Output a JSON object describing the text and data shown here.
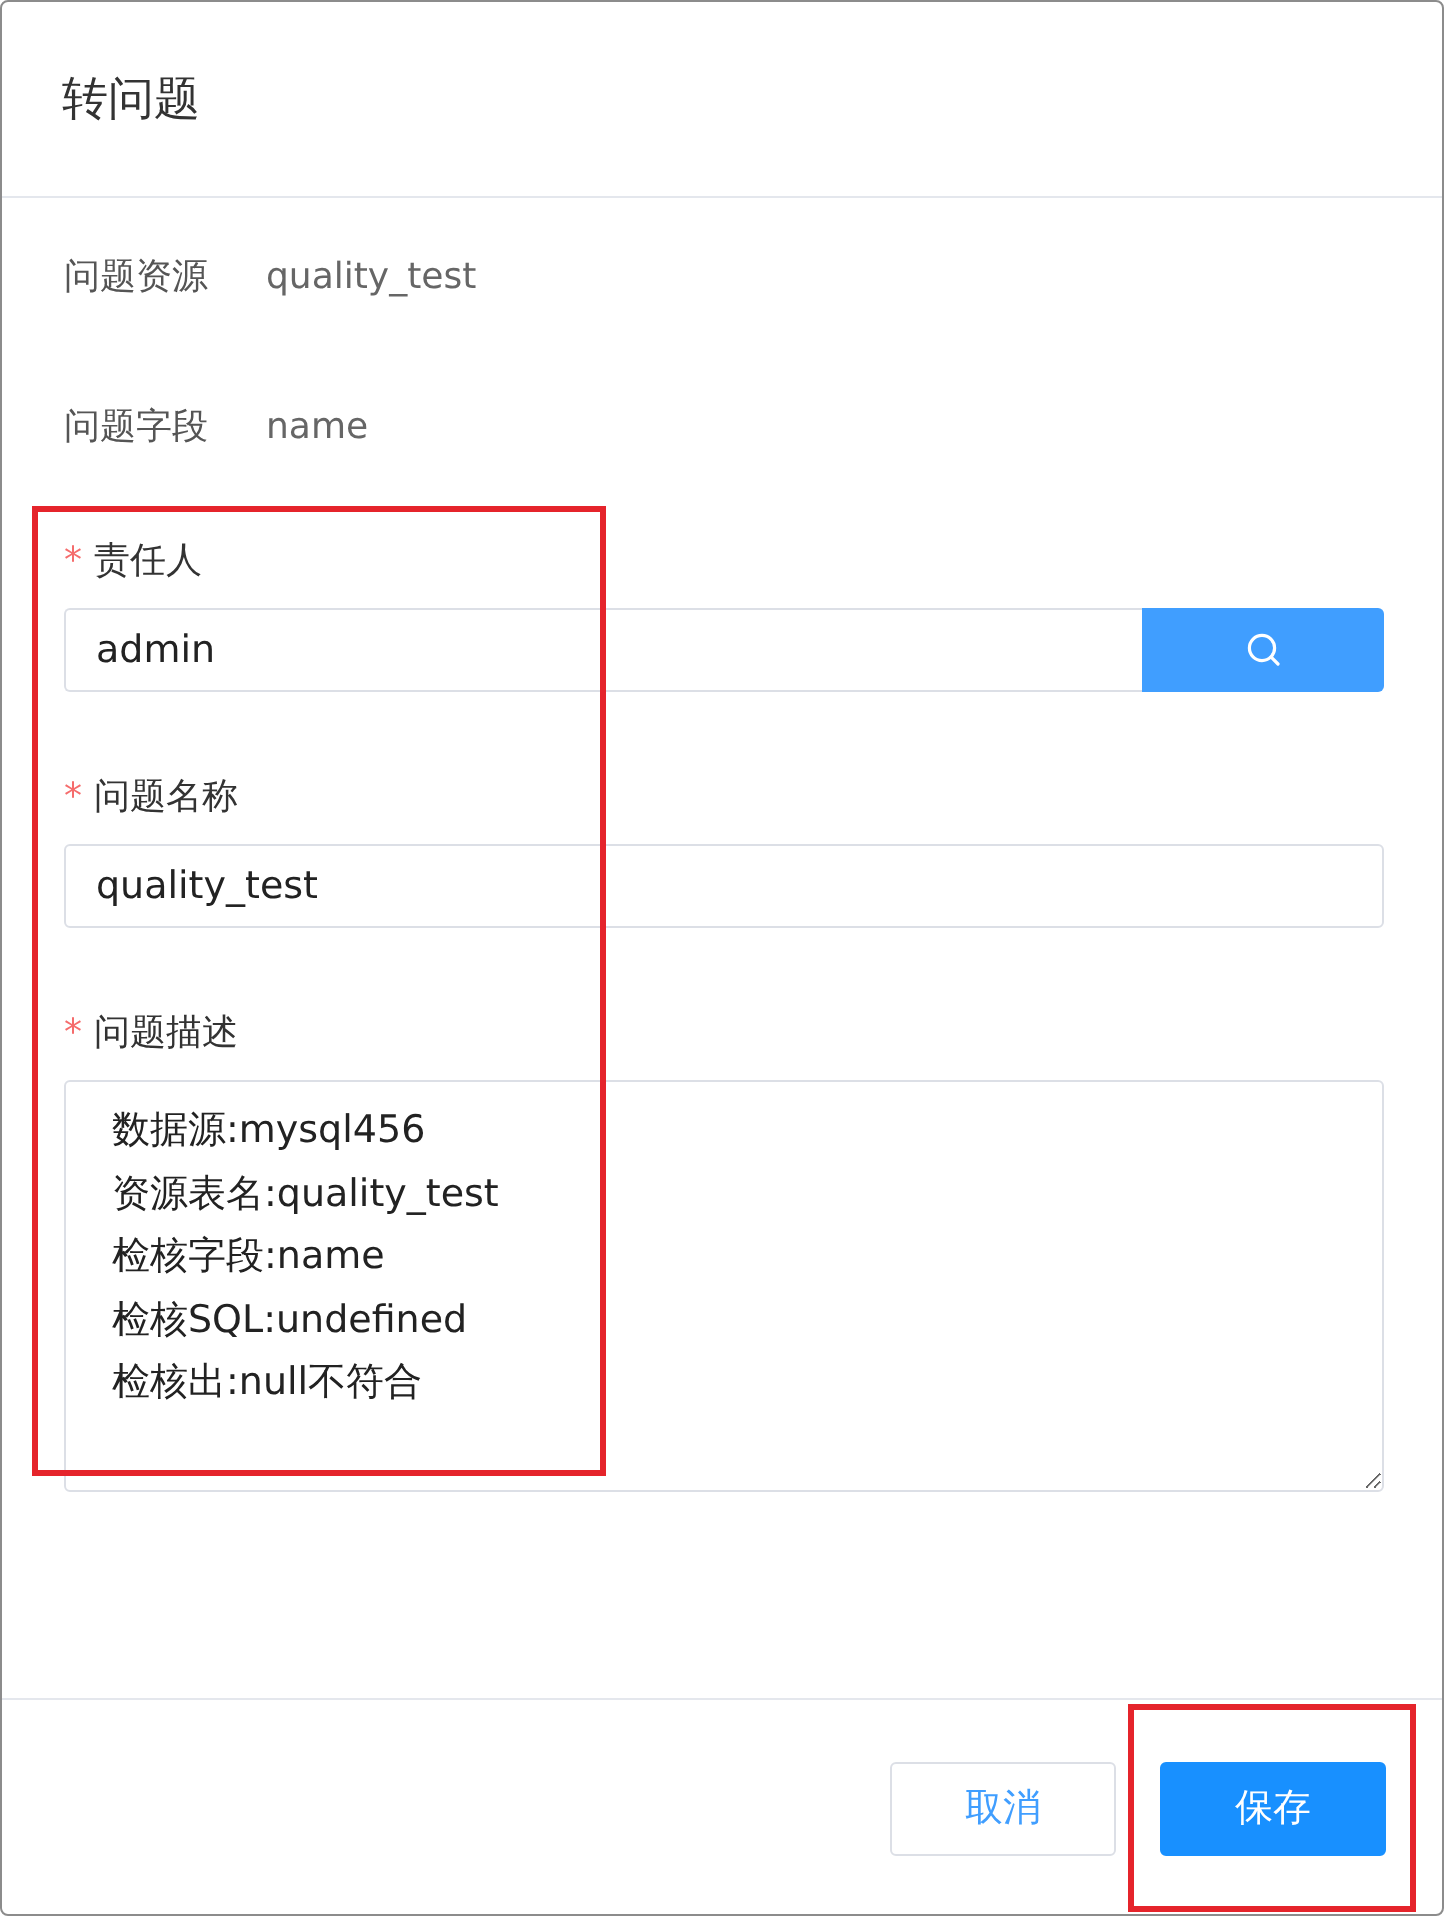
{
  "dialog": {
    "title": "转问题"
  },
  "info": [
    {
      "label": "问题资源",
      "value": "quality_test"
    },
    {
      "label": "问题字段",
      "value": "name"
    }
  ],
  "form": {
    "highlighted": true,
    "fields": [
      {
        "kind": "search",
        "label": "责任人",
        "required_mark": "*",
        "value": "admin"
      },
      {
        "kind": "text",
        "label": "问题名称",
        "required_mark": "*",
        "value": "quality_test"
      },
      {
        "kind": "textarea",
        "label": "问题描述",
        "required_mark": "*",
        "value": "数据源:mysql456\n资源表名:quality_test\n检核字段:name\n检核SQL:undefined\n检核出:null不符合"
      }
    ]
  },
  "buttons": [
    {
      "kind": "default",
      "label": "取消",
      "highlighted": false
    },
    {
      "kind": "primary",
      "label": "保存",
      "highlighted": true
    }
  ]
}
